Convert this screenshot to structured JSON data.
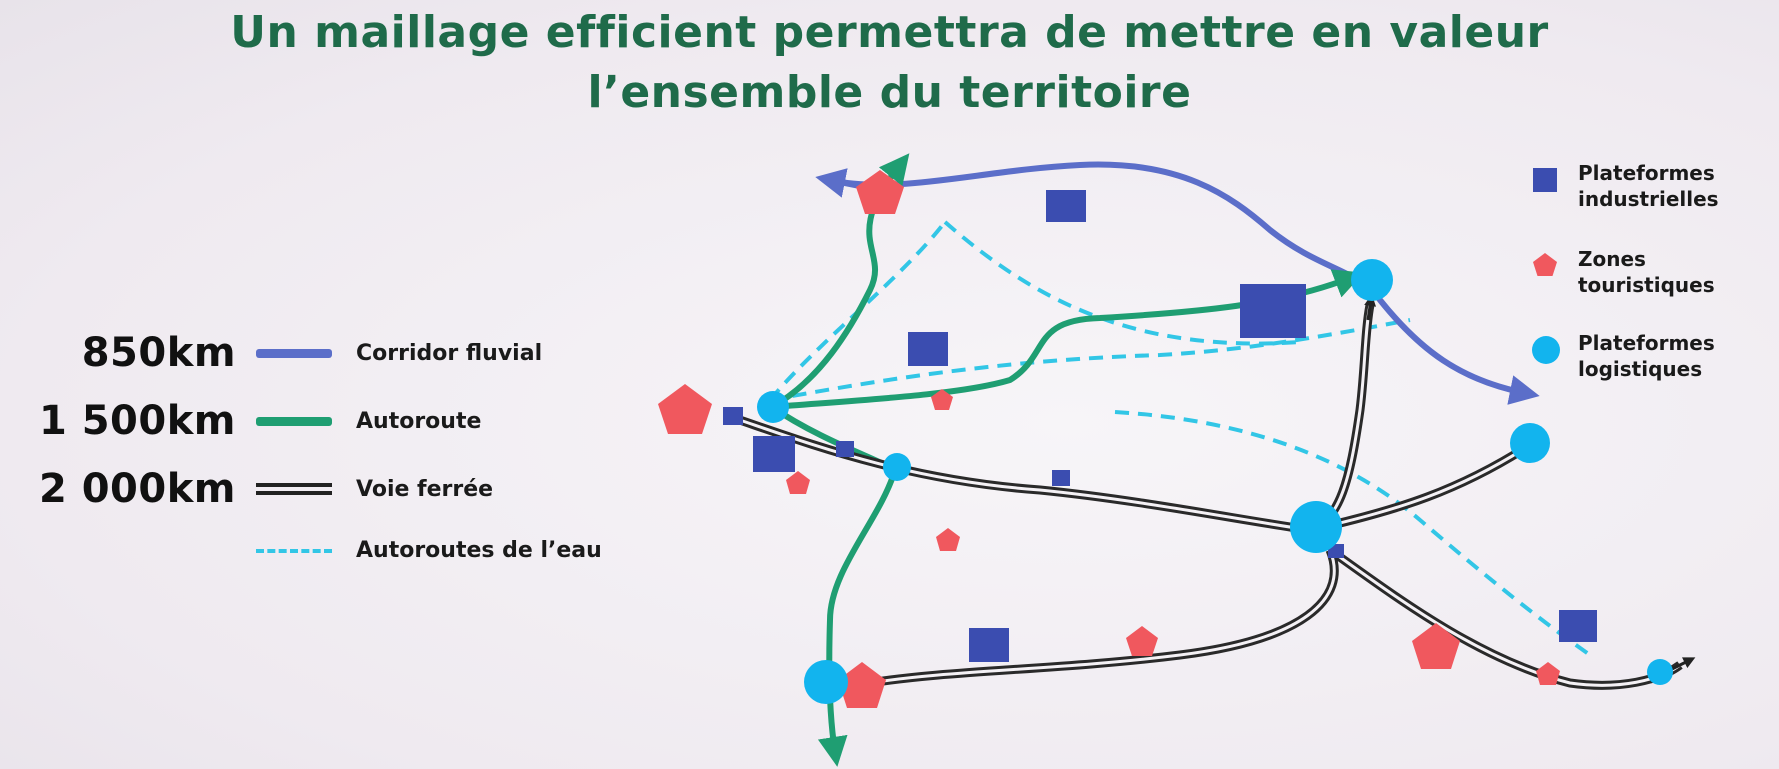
{
  "title": {
    "line1": "Un maillage efficient permettra de mettre en valeur",
    "line2": "l’ensemble du territoire"
  },
  "legend_networks": [
    {
      "length": "850km",
      "label": "Corridor fluvial",
      "color": "#5b6ec9",
      "style": "solid"
    },
    {
      "length": "1 500km",
      "label": "Autoroute",
      "color": "#1f9e72",
      "style": "solid"
    },
    {
      "length": "2 000km",
      "label": "Voie ferrée",
      "color": "#222222",
      "style": "double"
    },
    {
      "length": "",
      "label": "Autoroutes de l’eau",
      "color": "#32c6e6",
      "style": "dashed"
    }
  ],
  "legend_symbols": [
    {
      "label_line1": "Plateformes",
      "label_line2": "industrielles",
      "shape": "square",
      "color": "#3b4db0"
    },
    {
      "label_line1": "Zones",
      "label_line2": "touristiques",
      "shape": "pentagon",
      "color": "#f0585e"
    },
    {
      "label_line1": "Plateformes",
      "label_line2": "logistiques",
      "shape": "circle",
      "color": "#12b4ee"
    }
  ],
  "colors": {
    "fluvial": "#5b6ec9",
    "autoroute": "#1f9e72",
    "rail": "#2a2a2a",
    "eau": "#32c6e6",
    "industrial": "#3b4db0",
    "tourist": "#f0585e",
    "logistics": "#12b4ee",
    "title": "#1f6b4a"
  }
}
